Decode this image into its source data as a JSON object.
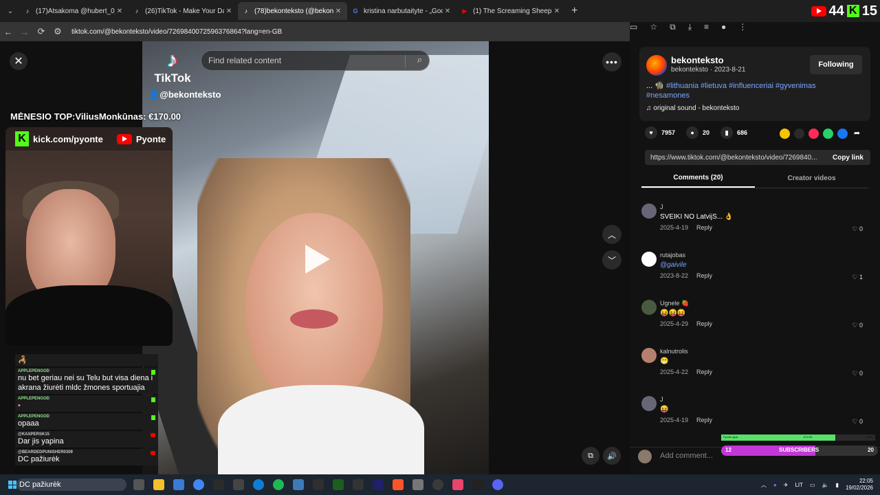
{
  "browser": {
    "tabs": [
      {
        "title": "(17)Atsakoma @hubert_0_0 #l...",
        "icon": "tiktok-icon"
      },
      {
        "title": "(26)TikTok - Make Your Day",
        "icon": "tiktok-icon"
      },
      {
        "title": "(78)bekonteksto (@bekontekst...",
        "icon": "tiktok-icon",
        "active": true
      },
      {
        "title": "kristina narbutaityte - „Google\"",
        "icon": "google-icon"
      },
      {
        "title": "(1) The Screaming Sheep (Origi...",
        "icon": "youtube-icon"
      }
    ],
    "url": "tiktok.com/@bekonteksto/video/7269840072596376864?lang=en-GB",
    "badge_left": "44",
    "badge_right": "15"
  },
  "video": {
    "logo_text": "TikTok",
    "handle": "@bekonteksto",
    "search_placeholder": "Find related content"
  },
  "stream_overlay": {
    "top_text": "MĖNESIO TOP:ViliusMonkūnas: €170.00",
    "kick_link": "kick.com/pyonte",
    "yt_name": "Pyonte",
    "chat": [
      {
        "user": "",
        "text": "🦂"
      },
      {
        "user": "APPLEPENGOD",
        "text": "nu bet geriau nei su Telu but visa diena i akrana žiurėti mldc žmones sportuajia"
      },
      {
        "user": "APPLEPENGOD",
        "text": "▪"
      },
      {
        "user": "APPLEPENGOD",
        "text": "opaaa"
      },
      {
        "user": "@KASPERSK15",
        "text": "Dar jis yapina"
      },
      {
        "user": "@BEARDEDPUNISHER0309",
        "text": "DC pažiurėk"
      }
    ]
  },
  "post": {
    "author": "bekonteksto",
    "sub": "bekonteksto · 2023-8-21",
    "follow_label": "Following",
    "desc_prefix": "... 🧌",
    "hashtags": "#lithuania #lietuva #influenceriai #gyvenimas #nesamones",
    "sound": "original sound - bekonteksto",
    "likes": "7957",
    "comments": "20",
    "saves": "686",
    "link": "https://www.tiktok.com/@bekonteksto/video/7269840...",
    "copy_label": "Copy link",
    "tab_comments": "Comments (20)",
    "tab_creator": "Creator videos"
  },
  "comments": [
    {
      "user": "J",
      "text": "SVEIKI NO LatvijS... 👌",
      "date": "2025-4-19",
      "reply": "Reply",
      "likes": "0"
    },
    {
      "user": "rutajobas",
      "text": "@gaivile",
      "date": "2023-8-22",
      "reply": "Reply",
      "likes": "1"
    },
    {
      "user": "Ugnele 🍓",
      "text": "😝😝😝",
      "date": "2025-4-29",
      "reply": "Reply",
      "likes": "0"
    },
    {
      "user": "kalnutrolis",
      "text": "😁",
      "date": "2025-4-22",
      "reply": "Reply",
      "likes": "0"
    },
    {
      "user": "J",
      "text": "😝",
      "date": "2025-4-19",
      "reply": "Reply",
      "likes": "0"
    }
  ],
  "add_comment": "Add comment...",
  "sub_goal": {
    "label_left": "Pyonte goal",
    "label_mid": "€74.00",
    "label_right": "€100",
    "fill_fraction": 0.74,
    "count_left": "12",
    "label": "SUBSCRIBERS",
    "count_right": "20",
    "sub_fraction": 0.6
  },
  "taskbar": {
    "search_text": "DC pažiurėk",
    "lang": "LIT",
    "time": "22:05",
    "date": "19/02/2026"
  }
}
